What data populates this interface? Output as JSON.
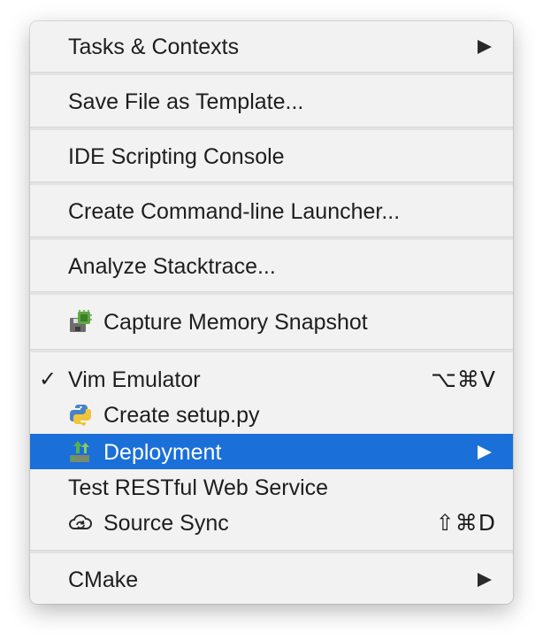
{
  "menu": {
    "items": [
      {
        "label": "Tasks & Contexts",
        "submenu": true
      },
      {
        "label": "Save File as Template..."
      },
      {
        "label": "IDE Scripting Console"
      },
      {
        "label": "Create Command-line Launcher..."
      },
      {
        "label": "Analyze Stacktrace..."
      },
      {
        "label": "Capture Memory Snapshot",
        "icon": "memory-snapshot-icon"
      },
      {
        "label": "Vim Emulator",
        "checked": true,
        "check_glyph": "✓",
        "shortcut": "⌥⌘V"
      },
      {
        "label": "Create setup.py",
        "icon": "python-icon"
      },
      {
        "label": "Deployment",
        "icon": "deployment-icon",
        "submenu": true,
        "highlighted": true
      },
      {
        "label": "Test RESTful Web Service"
      },
      {
        "label": "Source Sync",
        "icon": "cloud-sync-icon",
        "shortcut": "⇧⌘D"
      },
      {
        "label": "CMake",
        "submenu": true
      }
    ]
  },
  "colors": {
    "menu_background": "#f2f2f2",
    "highlight": "#1b6fd9",
    "text": "#1e1e1e",
    "highlight_text": "#ffffff"
  }
}
